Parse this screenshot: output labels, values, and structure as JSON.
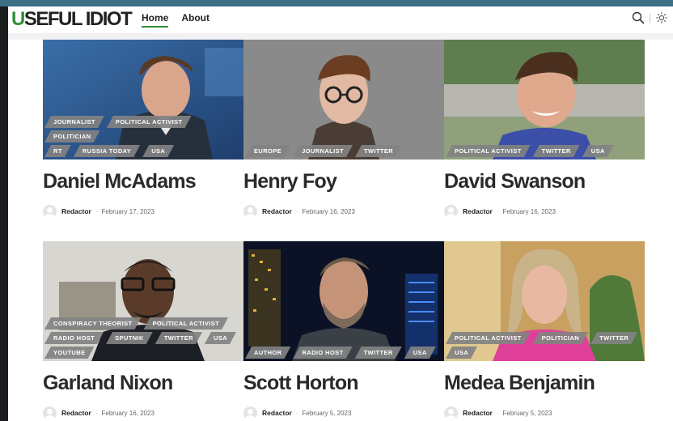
{
  "site": {
    "logo_first": "U",
    "logo_rest": "SEFUL IDIOT",
    "nav": [
      {
        "label": "Home",
        "active": true
      },
      {
        "label": "About",
        "active": false
      }
    ],
    "icons": [
      "search-icon",
      "theme-toggle-icon"
    ],
    "accent_color": "#2f8f3a"
  },
  "cards": [
    {
      "name": "Daniel McAdams",
      "author": "Redactor",
      "date": "February 17, 2023",
      "tag_rows": [
        [
          "JOURNALIST",
          "POLITICAL ACTIVIST",
          "POLITICIAN"
        ],
        [
          "RT",
          "RUSSIA TODAY",
          "USA"
        ]
      ]
    },
    {
      "name": "Henry Foy",
      "author": "Redactor",
      "date": "February 16, 2023",
      "tag_rows": [
        [
          "EUROPE",
          "JOURNALIST",
          "TWITTER"
        ]
      ]
    },
    {
      "name": "David Swanson",
      "author": "Redactor",
      "date": "February 16, 2023",
      "tag_rows": [
        [
          "POLITICAL ACTIVIST",
          "TWITTER",
          "USA"
        ]
      ]
    },
    {
      "name": "Garland Nixon",
      "author": "Redactor",
      "date": "February 16, 2023",
      "tag_rows": [
        [
          "CONSPIRACY THEORIST",
          "POLITICAL ACTIVIST"
        ],
        [
          "RADIO HOST",
          "SPUTNIK",
          "TWITTER",
          "USA"
        ],
        [
          "YOUTUBE"
        ]
      ]
    },
    {
      "name": "Scott Horton",
      "author": "Redactor",
      "date": "February 5, 2023",
      "tag_rows": [
        [
          "AUTHOR",
          "RADIO HOST",
          "TWITTER",
          "USA"
        ]
      ]
    },
    {
      "name": "Medea Benjamin",
      "author": "Redactor",
      "date": "February 5, 2023",
      "tag_rows": [
        [
          "POLITICAL ACTIVIST",
          "POLITICIAN",
          "TWITTER"
        ],
        [
          "USA"
        ]
      ]
    }
  ]
}
